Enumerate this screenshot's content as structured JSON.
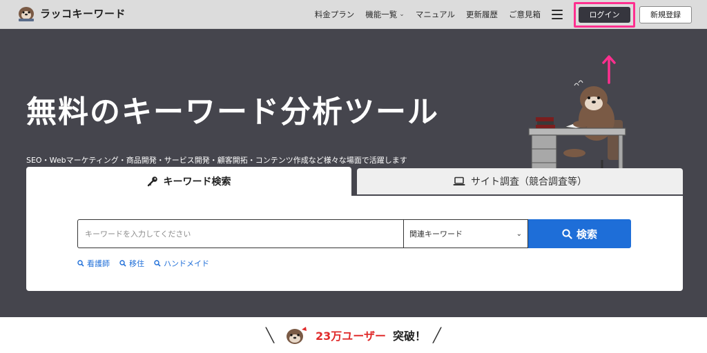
{
  "header": {
    "logo_text": "ラッコキーワード",
    "nav": [
      {
        "label": "料金プラン"
      },
      {
        "label": "機能一覧"
      },
      {
        "label": "マニュアル"
      },
      {
        "label": "更新履歴"
      },
      {
        "label": "ご意見箱"
      }
    ],
    "login_label": "ログイン",
    "register_label": "新規登録"
  },
  "hero": {
    "title": "無料のキーワード分析ツール",
    "subtitle": "SEO・Webマーケティング・商品開発・サービス開発・顧客開拓・コンテンツ作成など様々な場面で活躍します"
  },
  "tabs": {
    "keyword_label": "キーワード検索",
    "site_label": "サイト調査（競合調査等）"
  },
  "search": {
    "placeholder": "キーワードを入力してください",
    "select_value": "関連キーワード",
    "button_label": "検索",
    "suggestions": [
      {
        "label": "看護師"
      },
      {
        "label": "移住"
      },
      {
        "label": "ハンドメイド"
      }
    ]
  },
  "banner": {
    "users_count": "23万ユーザー",
    "users_suffix": "突破！"
  },
  "colors": {
    "header_bg": "#dcdcdc",
    "hero_bg": "#45454d",
    "accent_blue": "#1e6ed8",
    "highlight_pink": "#ff2f8f",
    "users_red": "#e02b2b"
  },
  "icons": [
    "otter-logo-icon",
    "chevron-down-icon",
    "hamburger-menu-icon",
    "up-arrow-icon",
    "key-icon",
    "laptop-icon",
    "search-icon",
    "otter-mascot-illustration"
  ]
}
